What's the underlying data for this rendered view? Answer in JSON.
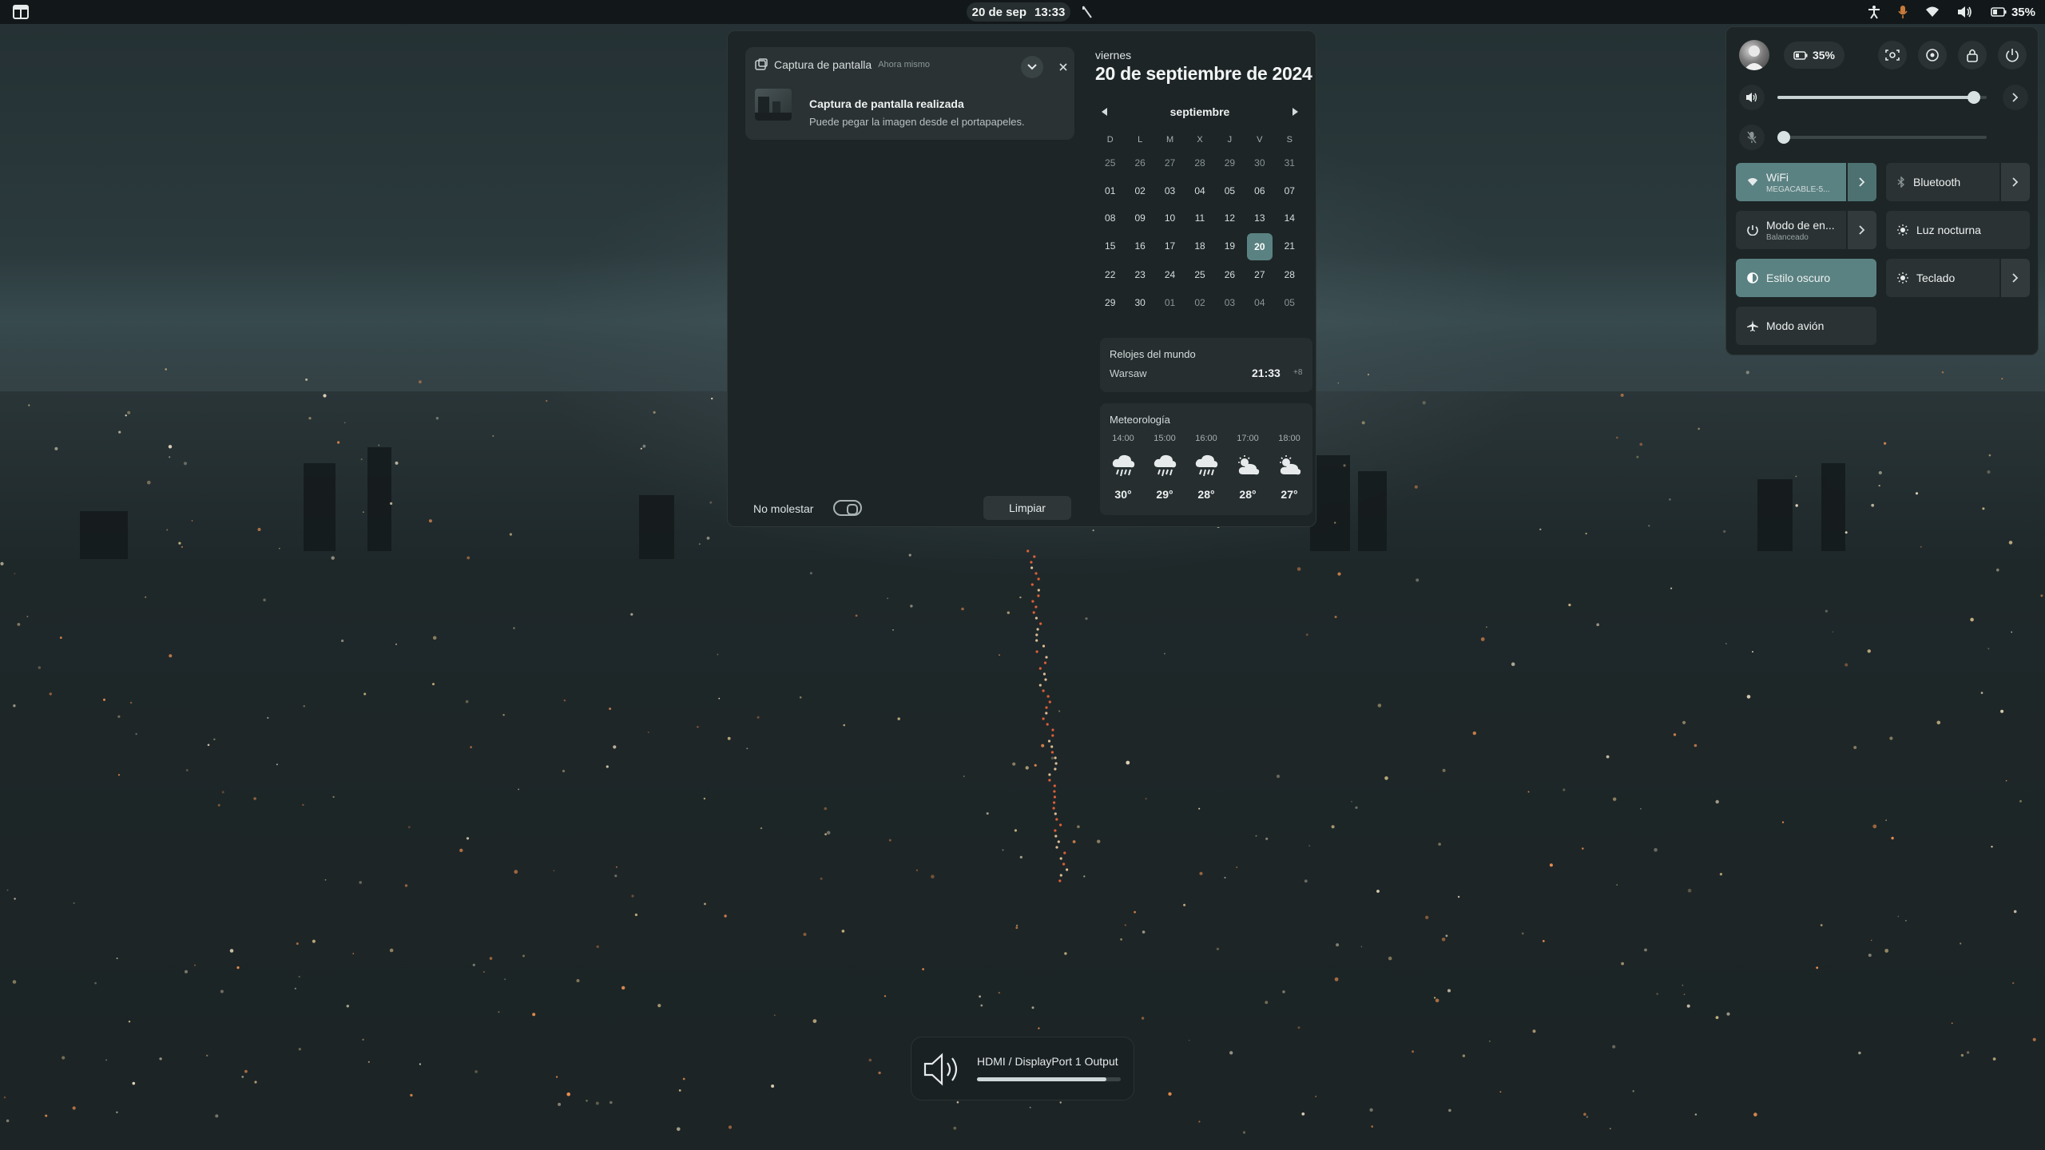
{
  "topbar": {
    "date": "20 de sep",
    "time": "13:33",
    "battery": "35%"
  },
  "notification": {
    "app": "Captura de pantalla",
    "time": "Ahora mismo",
    "title": "Captura de pantalla realizada",
    "body": "Puede pegar la imagen desde el portapapeles."
  },
  "dnd": {
    "label": "No molestar",
    "enabled": false
  },
  "clear_label": "Limpiar",
  "calendar": {
    "day_name": "viernes",
    "full_date": "20 de septiembre de 2024",
    "month": "septiembre",
    "weekdays": [
      "D",
      "L",
      "M",
      "X",
      "J",
      "V",
      "S"
    ],
    "weeks": [
      [
        "25",
        "26",
        "27",
        "28",
        "29",
        "30",
        "31"
      ],
      [
        "01",
        "02",
        "03",
        "04",
        "05",
        "06",
        "07"
      ],
      [
        "08",
        "09",
        "10",
        "11",
        "12",
        "13",
        "14"
      ],
      [
        "15",
        "16",
        "17",
        "18",
        "19",
        "20",
        "21"
      ],
      [
        "22",
        "23",
        "24",
        "25",
        "26",
        "27",
        "28"
      ],
      [
        "29",
        "30",
        "01",
        "02",
        "03",
        "04",
        "05"
      ]
    ],
    "today": "20"
  },
  "world_clocks": {
    "title": "Relojes del mundo",
    "city": "Warsaw",
    "time": "21:33",
    "offset": "+8"
  },
  "weather": {
    "title": "Meteorología",
    "forecast": [
      {
        "hour": "14:00",
        "temp": "30°",
        "icon": "rain-icon"
      },
      {
        "hour": "15:00",
        "temp": "29°",
        "icon": "rain-icon"
      },
      {
        "hour": "16:00",
        "temp": "28°",
        "icon": "rain-icon"
      },
      {
        "hour": "17:00",
        "temp": "28°",
        "icon": "partly-cloudy-icon"
      },
      {
        "hour": "18:00",
        "temp": "27°",
        "icon": "partly-cloudy-icon"
      }
    ]
  },
  "quick_settings": {
    "battery": "35%",
    "volume_level": 0.94,
    "mic_level": 0.0,
    "tiles": {
      "wifi": {
        "label": "WiFi",
        "sub": "MEGACABLE-5..."
      },
      "bluetooth": {
        "label": "Bluetooth"
      },
      "power_mode": {
        "label": "Modo de en...",
        "sub": "Balanceado"
      },
      "night_light": {
        "label": "Luz nocturna"
      },
      "dark_style": {
        "label": "Estilo oscuro"
      },
      "keyboard": {
        "label": "Teclado"
      },
      "airplane": {
        "label": "Modo avión"
      }
    }
  },
  "osd": {
    "label": "HDMI / DisplayPort 1 Output",
    "level": 0.9
  },
  "colors": {
    "accent": "#5b8282",
    "panel_bg": "#1d2526",
    "tile_bg": "#2a3233"
  }
}
